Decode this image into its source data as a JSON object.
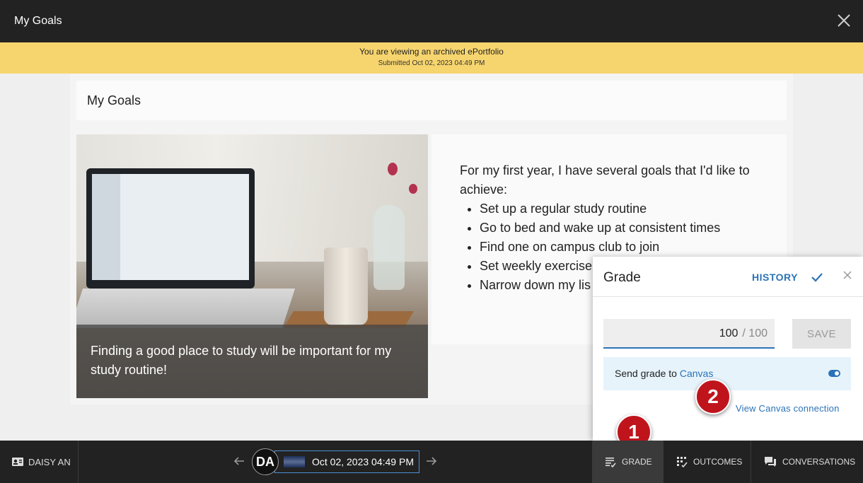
{
  "header": {
    "title": "My Goals"
  },
  "banner": {
    "line1": "You are viewing an archived ePortfolio",
    "line2": "Submitted Oct 02, 2023 04:49 PM"
  },
  "page": {
    "title": "My Goals",
    "caption": "Finding a good place to study will be important for my study routine!",
    "intro": "For my first year, I have several goals that I'd like to achieve:",
    "goals": [
      "Set up a regular study routine",
      "Go to bed and wake up at consistent times",
      "Find one on campus club to join",
      "Set weekly exercise",
      "Narrow down my lis"
    ]
  },
  "grade_panel": {
    "title": "Grade",
    "history_label": "HISTORY",
    "score": "100",
    "max_score": "/ 100",
    "save_label": "SAVE",
    "send_prefix": "Send grade to ",
    "send_target": "Canvas",
    "toggle_on": true,
    "view_connection": "View Canvas connection"
  },
  "markers": {
    "m1": "1",
    "m2": "2"
  },
  "bottombar": {
    "user": "DAISY AN",
    "avatar_initials": "DA",
    "date": "Oct 02, 2023 04:49 PM",
    "tabs": {
      "grade": "GRADE",
      "outcomes": "OUTCOMES",
      "conversations": "CONVERSATIONS"
    }
  },
  "colors": {
    "accent": "#2a73b8",
    "banner": "#f7d56e",
    "marker": "#c0141c",
    "bar": "#222222"
  }
}
